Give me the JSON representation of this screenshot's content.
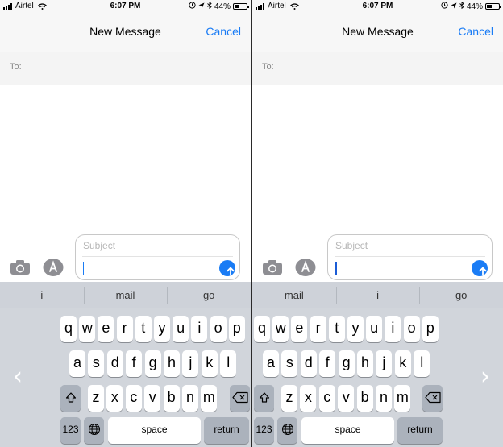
{
  "screens": [
    {
      "status": {
        "carrier": "Airtel",
        "time": "6:07 PM",
        "battery": "44%",
        "battery_level": 0.44
      },
      "nav": {
        "title": "New Message",
        "cancel": "Cancel"
      },
      "to_label": "To:",
      "compose": {
        "subject_placeholder": "Subject"
      },
      "suggestions": [
        "i",
        "mail",
        "go"
      ],
      "keyboard": {
        "row1": [
          "q",
          "w",
          "e",
          "r",
          "t",
          "y",
          "u",
          "i",
          "o",
          "p"
        ],
        "row2": [
          "a",
          "s",
          "d",
          "f",
          "g",
          "h",
          "j",
          "k",
          "l"
        ],
        "row3": [
          "z",
          "x",
          "c",
          "v",
          "b",
          "n",
          "m"
        ],
        "numbers_label": "123",
        "space_label": "space",
        "return_label": "return",
        "side_chevron": "‹"
      }
    },
    {
      "status": {
        "carrier": "Airtel",
        "time": "6:07 PM",
        "battery": "44%",
        "battery_level": 0.44
      },
      "nav": {
        "title": "New Message",
        "cancel": "Cancel"
      },
      "to_label": "To:",
      "compose": {
        "subject_placeholder": "Subject"
      },
      "suggestions": [
        "mail",
        "i",
        "go"
      ],
      "keyboard": {
        "row1": [
          "q",
          "w",
          "e",
          "r",
          "t",
          "y",
          "u",
          "i",
          "o",
          "p"
        ],
        "row2": [
          "a",
          "s",
          "d",
          "f",
          "g",
          "h",
          "j",
          "k",
          "l"
        ],
        "row3": [
          "z",
          "x",
          "c",
          "v",
          "b",
          "n",
          "m"
        ],
        "numbers_label": "123",
        "space_label": "space",
        "return_label": "return",
        "side_chevron": "›"
      }
    }
  ],
  "colors": {
    "accent": "#1a7cf5",
    "keyboard_bg": "#d1d5db",
    "key_dark": "#abb2bc"
  }
}
